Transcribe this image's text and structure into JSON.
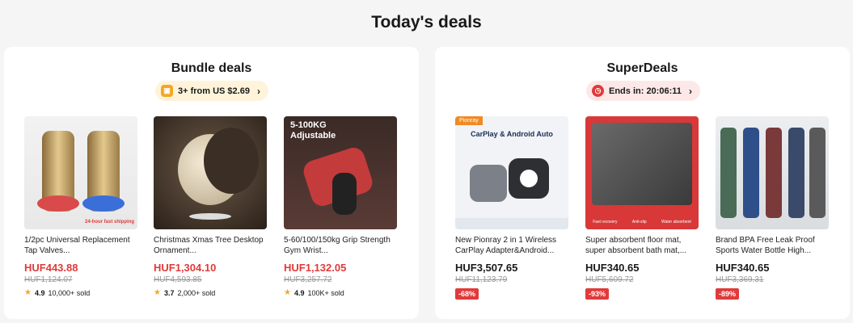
{
  "page_title": "Today's deals",
  "bundle": {
    "title": "Bundle deals",
    "pill_text": "3+ from US $2.69",
    "products": [
      {
        "title": "1/2pc Universal Replacement Tap Valves...",
        "price": "HUF443.88",
        "old_price": "HUF1,124.07",
        "rating": "4.9",
        "sold": "10,000+ sold",
        "image_tag": "24-hour fast shipping"
      },
      {
        "title": "Christmas Xmas Tree Desktop Ornament...",
        "price": "HUF1,304.10",
        "old_price": "HUF4,593.85",
        "rating": "3.7",
        "sold": "2,000+ sold"
      },
      {
        "title": "5-60/100/150kg Grip Strength Gym Wrist...",
        "price": "HUF1,132.05",
        "old_price": "HUF3,257.72",
        "rating": "4.9",
        "sold": "100K+ sold",
        "image_text_1": "5-100KG",
        "image_text_2": "Adjustable"
      }
    ]
  },
  "super": {
    "title": "SuperDeals",
    "pill_text": "Ends in: 20:06:11",
    "products": [
      {
        "title": "New Pionray 2 in 1 Wireless CarPlay Adapter&Android...",
        "price": "HUF3,507.65",
        "old_price": "HUF11,123.79",
        "discount": "-68%",
        "image_tag": "Pionray",
        "image_head": "CarPlay & Android Auto"
      },
      {
        "title": "Super absorbent floor mat, super absorbent bath mat,...",
        "price": "HUF340.65",
        "old_price": "HUF5,609.72",
        "discount": "-93%",
        "image_labels": [
          "Fast recovery",
          "Anti-slip",
          "Water absorbent"
        ]
      },
      {
        "title": "Brand BPA Free Leak Proof Sports Water Bottle High...",
        "price": "HUF340.65",
        "old_price": "HUF3,369.31",
        "discount": "-89%"
      }
    ]
  },
  "colors": {
    "accent_red": "#e13a3a",
    "bundle_pill_bg": "#fff4d9",
    "super_pill_bg": "#fde8e8"
  }
}
